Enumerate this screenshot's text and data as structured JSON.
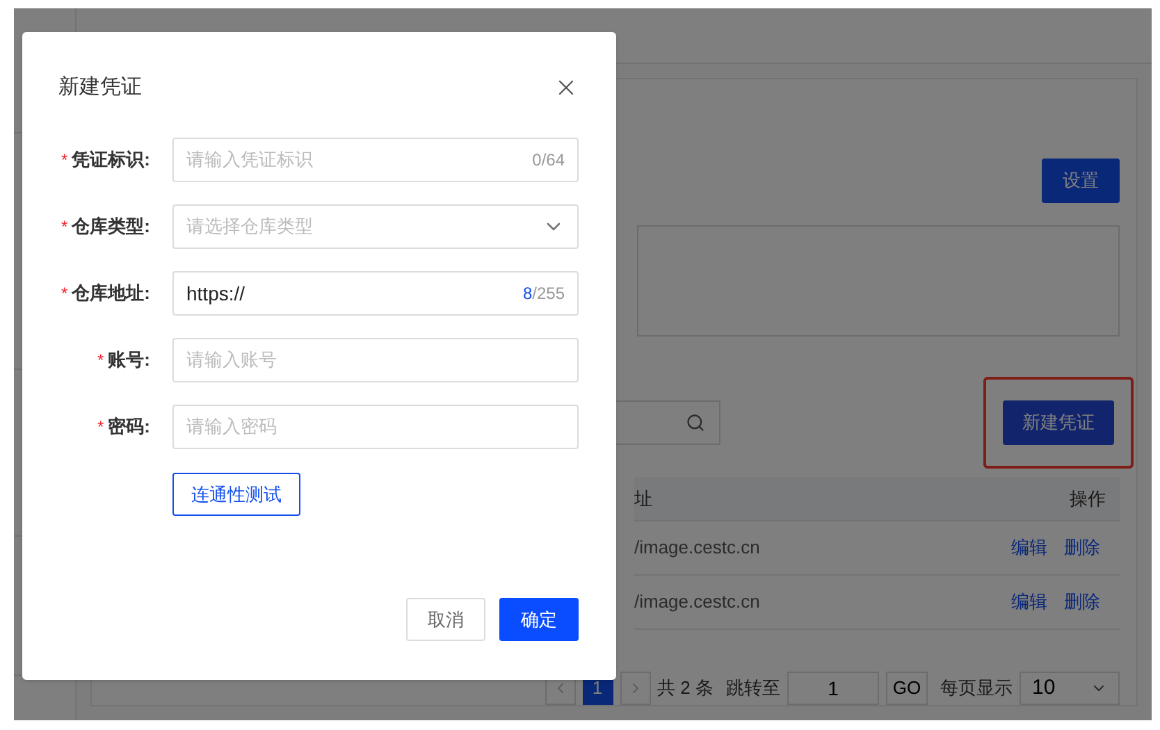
{
  "background": {
    "settings_button": "设置",
    "new_button": {
      "label": "新建凭证",
      "highlighted": true
    },
    "table": {
      "columns": [
        "址",
        "操作"
      ],
      "rows": [
        {
          "address": "/image.cestc.cn",
          "actions": [
            "编辑",
            "删除"
          ]
        },
        {
          "address": "/image.cestc.cn",
          "actions": [
            "编辑",
            "删除"
          ]
        }
      ]
    },
    "pagination": {
      "pages": [
        {
          "label": "1",
          "selected": true
        }
      ],
      "total": "共 2 条",
      "jump_label": "跳转至",
      "jump_value": "1",
      "go": "GO",
      "page_size_label": "每页显示",
      "page_size": "10"
    }
  },
  "dialog": {
    "title": "新建凭证",
    "fields": [
      {
        "label": "凭证标识:",
        "mark": "*",
        "kind": "input",
        "placeholder": "请输入凭证标识",
        "counter": {
          "count": "0",
          "limit": "/64"
        }
      },
      {
        "label": "仓库类型:",
        "mark": "*",
        "kind": "select",
        "placeholder": "请选择仓库类型"
      },
      {
        "label": "仓库地址:",
        "mark": "*",
        "kind": "input",
        "value": "https://",
        "counter": {
          "count": "8",
          "limit": "/255"
        }
      },
      {
        "label": "账号:",
        "mark": "*",
        "kind": "input",
        "placeholder": "请输入账号"
      },
      {
        "label": "密码:",
        "mark": "*",
        "kind": "input",
        "placeholder": "请输入密码"
      }
    ],
    "test_button": "连通性测试",
    "buttons": [
      {
        "label": "取消",
        "kind": "secondary"
      },
      {
        "label": "确定",
        "kind": "primary"
      }
    ]
  }
}
